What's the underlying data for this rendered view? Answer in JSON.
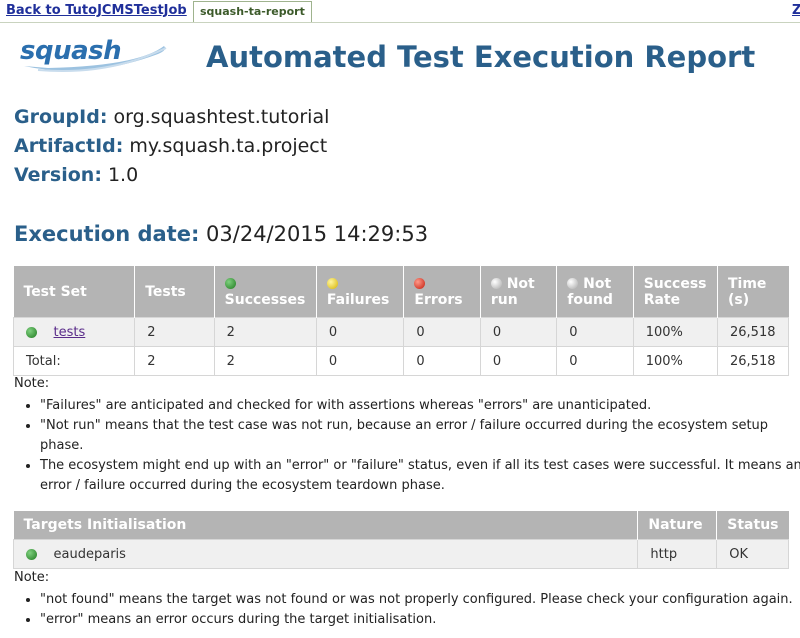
{
  "tabs": {
    "back_label": "Back to TutoJCMSTestJob",
    "active_label": "squash-ta-report",
    "overflow_label": "Z"
  },
  "header": {
    "logo_text": "squash",
    "title": "Automated Test Execution Report"
  },
  "meta": {
    "group_key": "GroupId:",
    "group_val": "org.squashtest.tutorial",
    "artifact_key": "ArtifactId:",
    "artifact_val": "my.squash.ta.project",
    "version_key": "Version:",
    "version_val": "1.0"
  },
  "execution": {
    "key": "Execution date:",
    "value": "03/24/2015 14:29:53"
  },
  "results": {
    "headers": [
      "Test Set",
      "Tests",
      "Successes",
      "Failures",
      "Errors",
      "Not run",
      "Not found",
      "Success Rate",
      "Time (s)"
    ],
    "rows": [
      {
        "name": "tests",
        "tests": "2",
        "successes": "2",
        "failures": "0",
        "errors": "0",
        "not_run": "0",
        "not_found": "0",
        "rate": "100%",
        "time": "26,518"
      }
    ],
    "total": {
      "name": "Total:",
      "tests": "2",
      "successes": "2",
      "failures": "0",
      "errors": "0",
      "not_run": "0",
      "not_found": "0",
      "rate": "100%",
      "time": "26,518"
    }
  },
  "notes1": {
    "label": "Note:",
    "items": [
      "\"Failures\" are anticipated and checked for with assertions whereas \"errors\" are unanticipated.",
      "\"Not run\" means that the test case was not run, because an error / failure occurred during the ecosystem setup phase.",
      "The ecosystem might end up with an \"error\" or \"failure\" status, even if all its test cases were successful. It means an error / failure occurred during the ecosystem teardown phase."
    ]
  },
  "targets": {
    "headers": [
      "Targets Initialisation",
      "Nature",
      "Status"
    ],
    "rows": [
      {
        "name": "eaudeparis",
        "nature": "http",
        "status": "OK"
      }
    ]
  },
  "notes2": {
    "label": "Note:",
    "items": [
      "\"not found\" means the target was not found or was not properly configured. Please check your configuration again.",
      "\"error\" means an error occurs during the target initialisation."
    ]
  },
  "colors": {
    "heading": "#2a5f8a",
    "table_header": "#b4b4b4",
    "success": "#1f7a1f",
    "failure": "#d6b300",
    "error": "#c21a0a"
  }
}
